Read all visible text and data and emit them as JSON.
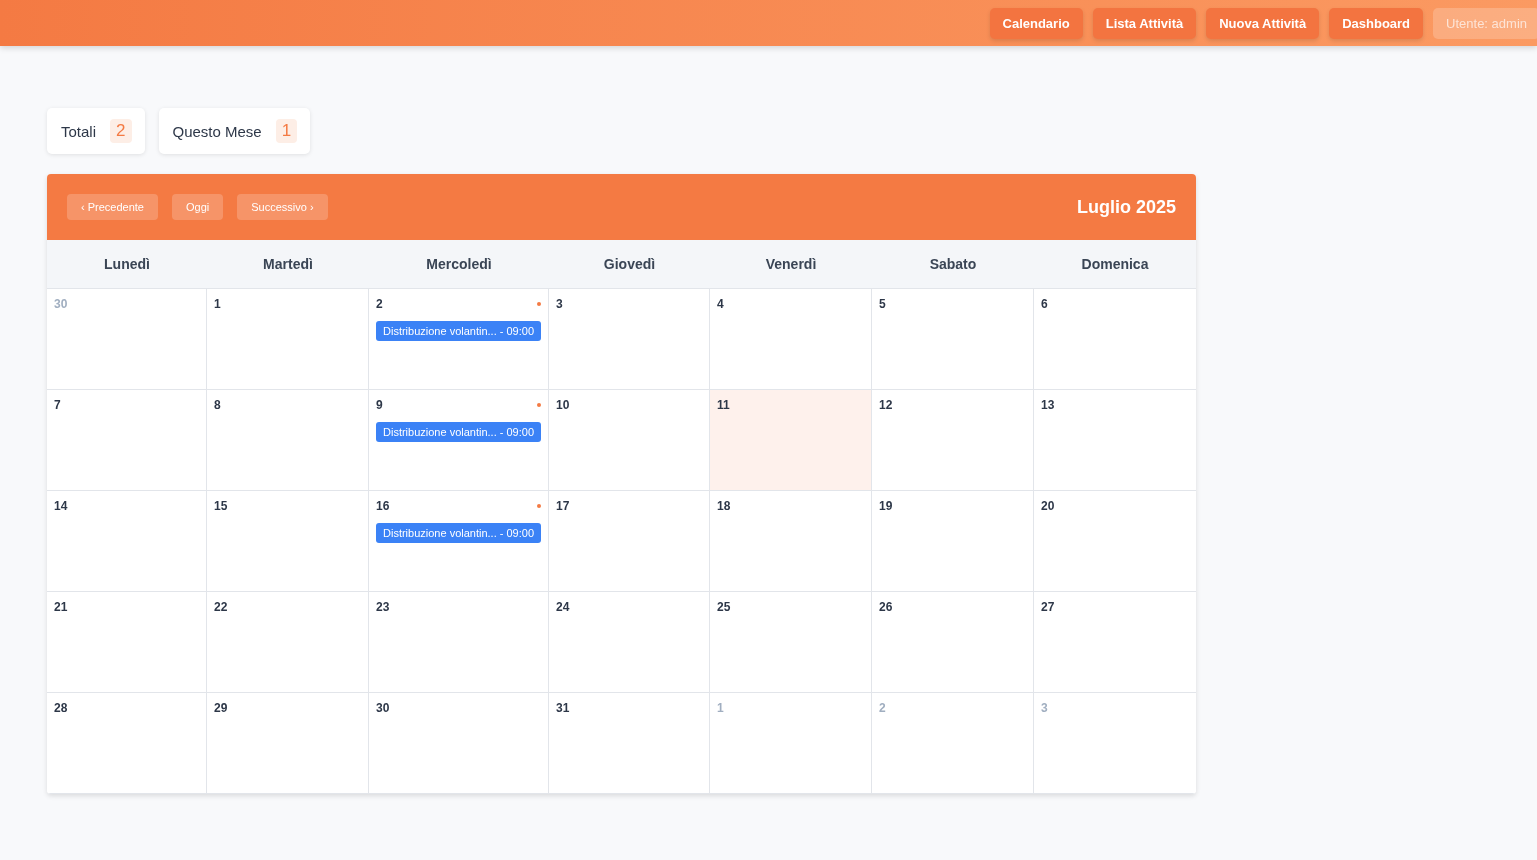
{
  "nav": [
    {
      "label": "Calendario",
      "kind": "button"
    },
    {
      "label": "Lista Attività",
      "kind": "button"
    },
    {
      "label": "Nuova Attività",
      "kind": "button"
    },
    {
      "label": "Dashboard",
      "kind": "button"
    },
    {
      "label": "Utente: admin",
      "kind": "user"
    }
  ],
  "stats": [
    {
      "label": "Totali",
      "count": "2"
    },
    {
      "label": "Questo Mese",
      "count": "1"
    }
  ],
  "calendar": {
    "buttons": [
      "‹ Precedente",
      "Oggi",
      "Successivo ›"
    ],
    "title": "Luglio 2025",
    "weekdays": [
      "Lunedì",
      "Martedì",
      "Mercoledì",
      "Giovedì",
      "Venerdì",
      "Sabato",
      "Domenica"
    ],
    "weeks": [
      [
        {
          "day": "30",
          "other_month": true
        },
        {
          "day": "1"
        },
        {
          "day": "2",
          "dot": true,
          "events": [
            "Distribuzione volantin... - 09:00"
          ]
        },
        {
          "day": "3"
        },
        {
          "day": "4"
        },
        {
          "day": "5"
        },
        {
          "day": "6"
        }
      ],
      [
        {
          "day": "7"
        },
        {
          "day": "8"
        },
        {
          "day": "9",
          "dot": true,
          "events": [
            "Distribuzione volantin... - 09:00"
          ]
        },
        {
          "day": "10"
        },
        {
          "day": "11",
          "today": true
        },
        {
          "day": "12"
        },
        {
          "day": "13"
        }
      ],
      [
        {
          "day": "14"
        },
        {
          "day": "15"
        },
        {
          "day": "16",
          "dot": true,
          "events": [
            "Distribuzione volantin... - 09:00"
          ]
        },
        {
          "day": "17"
        },
        {
          "day": "18"
        },
        {
          "day": "19"
        },
        {
          "day": "20"
        }
      ],
      [
        {
          "day": "21"
        },
        {
          "day": "22"
        },
        {
          "day": "23"
        },
        {
          "day": "24"
        },
        {
          "day": "25"
        },
        {
          "day": "26"
        },
        {
          "day": "27"
        }
      ],
      [
        {
          "day": "28"
        },
        {
          "day": "29"
        },
        {
          "day": "30"
        },
        {
          "day": "31"
        },
        {
          "day": "1",
          "other_month": true
        },
        {
          "day": "2",
          "other_month": true
        },
        {
          "day": "3",
          "other_month": true
        }
      ]
    ]
  }
}
